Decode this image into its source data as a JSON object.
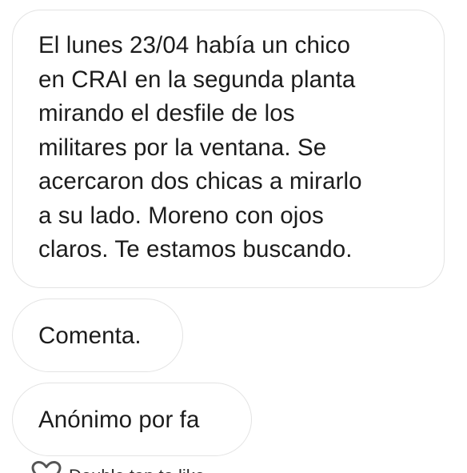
{
  "messages": [
    {
      "text": "El lunes 23/04 había un chico\nen CRAI en la segunda planta\nmirando el desfile de los\nmilitares por la ventana. Se\nacercaron dos chicas a mirarlo\na su lado. Moreno con ojos\nclaros. Te estamos buscando."
    },
    {
      "text": "Comenta."
    },
    {
      "text": "Anónimo por fa"
    }
  ],
  "footer": {
    "icon": "heart-outline-icon",
    "text": "Double tap to like"
  },
  "colors": {
    "bubble_border": "#e3e3e3",
    "text": "#1c1c1c",
    "background": "#ffffff"
  }
}
